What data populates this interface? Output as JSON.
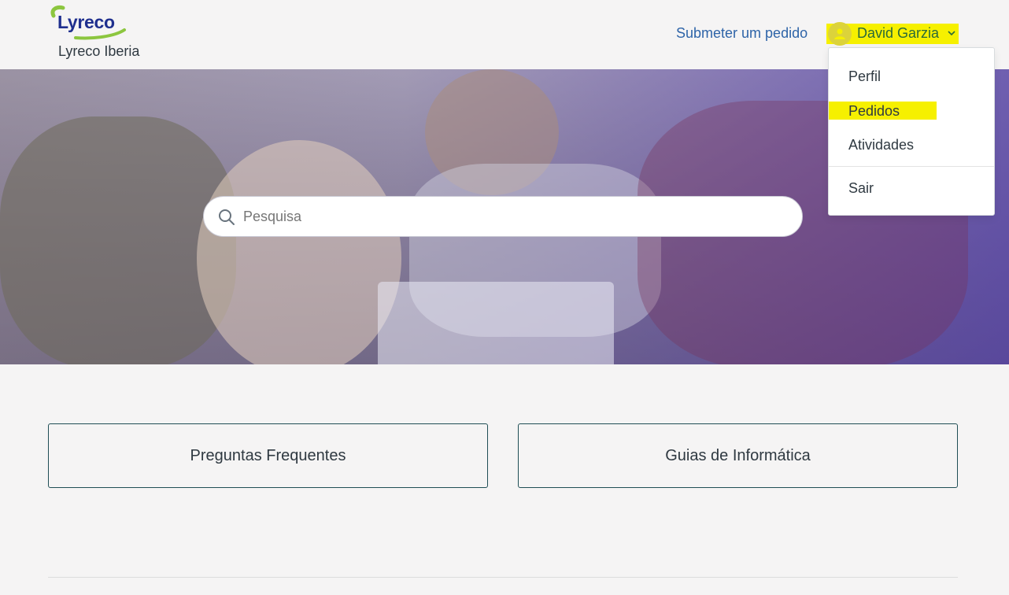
{
  "header": {
    "logo_text": "Lyreco",
    "brand_name": "Lyreco Iberia",
    "submit_request": "Submeter um pedido",
    "user_name": "David Garzia"
  },
  "search": {
    "placeholder": "Pesquisa"
  },
  "user_menu": {
    "items": [
      {
        "label": "Perfil"
      },
      {
        "label": "Pedidos"
      },
      {
        "label": "Atividades"
      },
      {
        "label": "Sair"
      }
    ]
  },
  "cards": [
    {
      "label": "Preguntas Frequentes"
    },
    {
      "label": "Guias de Informática"
    }
  ],
  "colors": {
    "highlight": "#f6f000",
    "link": "#2e64a8",
    "logo_blue": "#1f2f8e",
    "logo_green": "#8cc63f",
    "card_border": "#1f4e55"
  },
  "icons": {
    "search": "search-icon",
    "avatar": "user-avatar-icon",
    "chevron": "chevron-down-icon"
  }
}
